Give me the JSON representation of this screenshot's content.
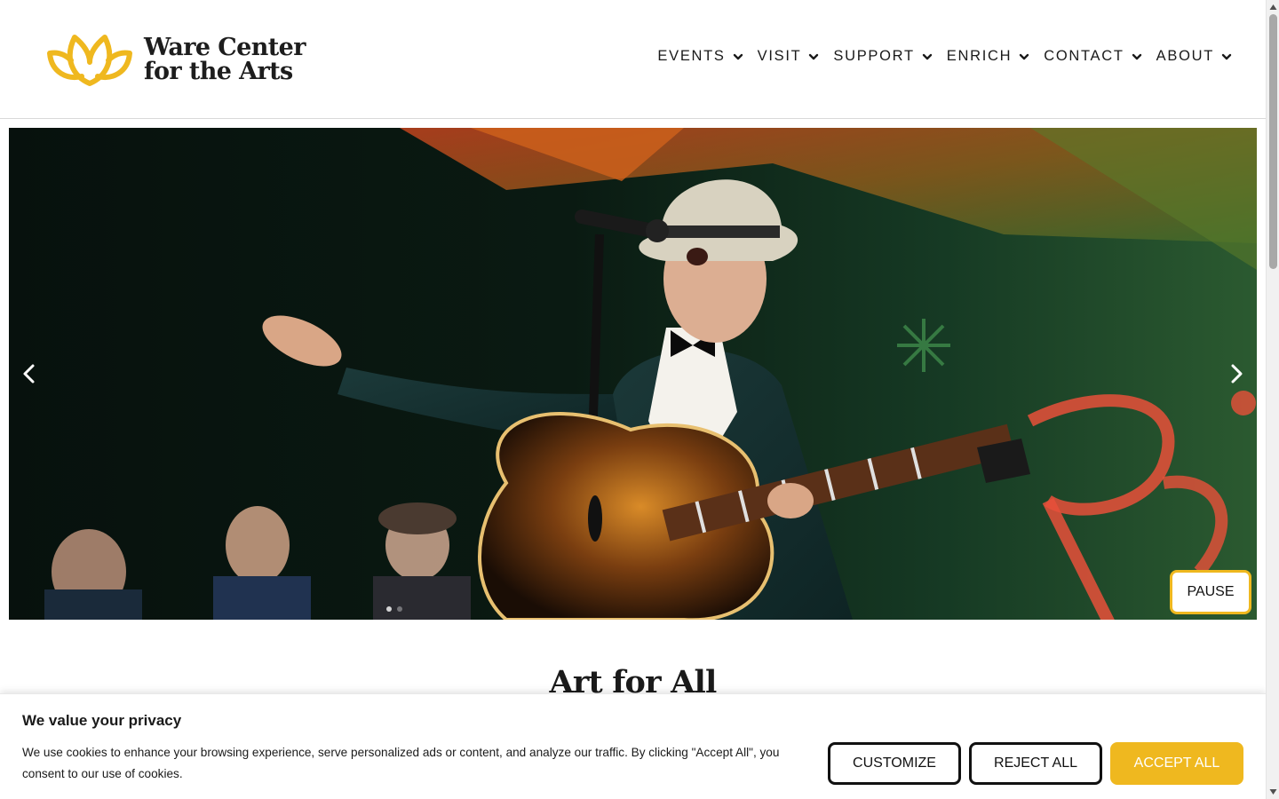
{
  "brand": {
    "name_line1": "Ware Center",
    "name_line2": "for the Arts",
    "accent_color": "#efb81f"
  },
  "nav": {
    "items": [
      {
        "label": "EVENTS",
        "icon": "chevron-down-icon"
      },
      {
        "label": "VISIT",
        "icon": "chevron-down-icon"
      },
      {
        "label": "SUPPORT",
        "icon": "chevron-down-icon"
      },
      {
        "label": "ENRICH",
        "icon": "chevron-down-icon"
      },
      {
        "label": "CONTACT",
        "icon": "chevron-down-icon"
      },
      {
        "label": "ABOUT",
        "icon": "chevron-down-icon"
      }
    ]
  },
  "hero": {
    "pause_label": "PAUSE",
    "prev_icon": "chevron-left-icon",
    "next_icon": "chevron-right-icon",
    "slide_count": 2,
    "active_slide": 1
  },
  "main": {
    "heading": "Art for All"
  },
  "cookie": {
    "title": "We value your privacy",
    "text": "We use cookies to enhance your browsing experience, serve personalized ads or content, and analyze our traffic. By clicking \"Accept All\", you consent to our use of cookies.",
    "customize_label": "CUSTOMIZE",
    "reject_label": "REJECT ALL",
    "accept_label": "ACCEPT ALL"
  }
}
